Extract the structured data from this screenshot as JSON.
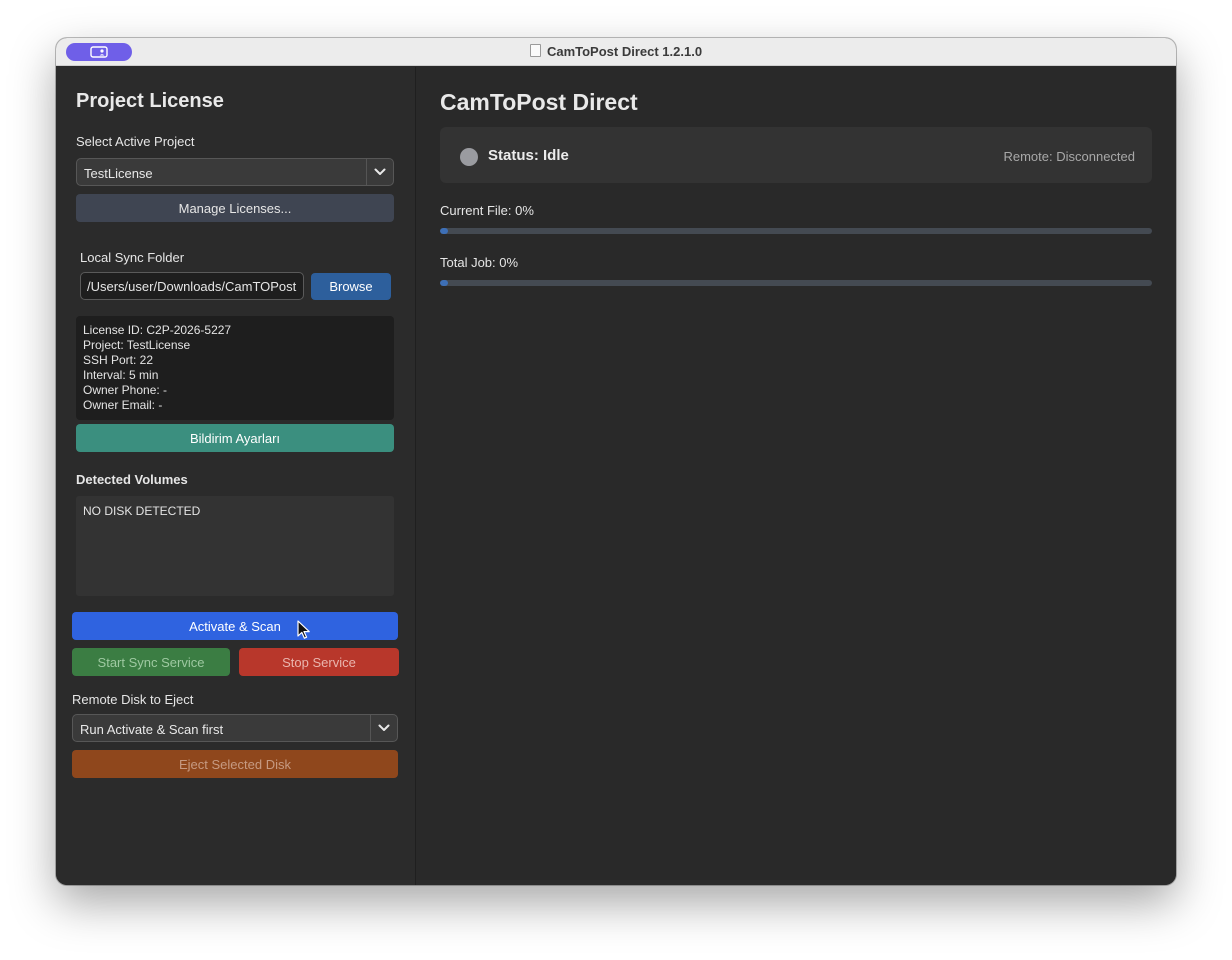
{
  "window": {
    "title": "CamToPost Direct 1.2.1.0"
  },
  "sidebar": {
    "heading": "Project License",
    "project_label": "Select Active Project",
    "project_selected": "TestLicense",
    "manage_button": "Manage Licenses...",
    "sync_label": "Local Sync Folder",
    "sync_path": "/Users/user/Downloads/CamTOPost",
    "browse_button": "Browse",
    "license_info": [
      "License ID: C2P-2026-5227",
      "Project: TestLicense",
      "SSH Port: 22",
      "Interval: 5 min",
      "Owner Phone: -",
      "Owner Email: -"
    ],
    "notify_button": "Bildirim Ayarları",
    "volumes_label": "Detected Volumes",
    "volumes_text": "NO DISK DETECTED",
    "activate_button": "Activate & Scan",
    "start_button": "Start Sync Service",
    "stop_button": "Stop Service",
    "eject_label": "Remote Disk to Eject",
    "eject_selected": "Run Activate & Scan first",
    "eject_button": "Eject Selected Disk"
  },
  "main": {
    "title": "CamToPost Direct",
    "status": "Status: Idle",
    "remote": "Remote: Disconnected",
    "current_file_label": "Current File: 0%",
    "current_file_progress": 0,
    "total_job_label": "Total Job: 0%",
    "total_job_progress": 0
  },
  "colors": {
    "accent_blue": "#2f63e0",
    "teal": "#3b8f7f",
    "green": "#3b7d43",
    "red": "#b8372b",
    "orange": "#8f471c",
    "progress": "#3d6fb6"
  },
  "icons": {
    "titlebar_pill": "sidebar-toggle-icon",
    "title_doc": "document-icon",
    "status_dot": "status-dot-icon",
    "dropdown": "chevron-down-icon"
  }
}
